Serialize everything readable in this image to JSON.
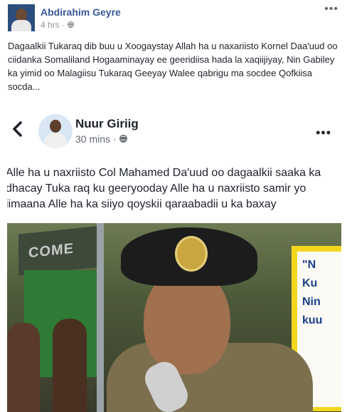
{
  "post": {
    "author": "Abdirahim Geyre",
    "time": "4 hrs",
    "privacy_sep": "·",
    "more_icon": "•••",
    "caption": "Dagaalkii Tukaraq dib buu u Xoogaystay Allah ha u naxariisto Kornel Daa'uud oo ciidanka Somaliland Hogaaminayay ee geeridiisa hada la xaqiijiyay, Nin Gabiley ka yimid oo Malagiisu Tukaraq Geeyay Walee qabrigu ma socdee Qofkiisa socda..."
  },
  "screenshot": {
    "author": "Nuur Giriig",
    "time": "30 mins",
    "privacy_sep": "·",
    "more_icon": "•••",
    "text": "Alle ha u naxriisto Col Mahamed Da'uud oo dagaalkii saaka ka dhacay Tuka raq ku geeryooday Alle ha u naxriisto samir yo iimaana Alle ha ka siiyo qoyskii qaraabadii u ka baxay",
    "photo": {
      "banner_text": "COME",
      "sign_text": "\"N\nKu\nNin\nkuu"
    }
  },
  "colors": {
    "name_link": "#385898",
    "meta_gray": "#90949c",
    "text": "#1d2129"
  }
}
